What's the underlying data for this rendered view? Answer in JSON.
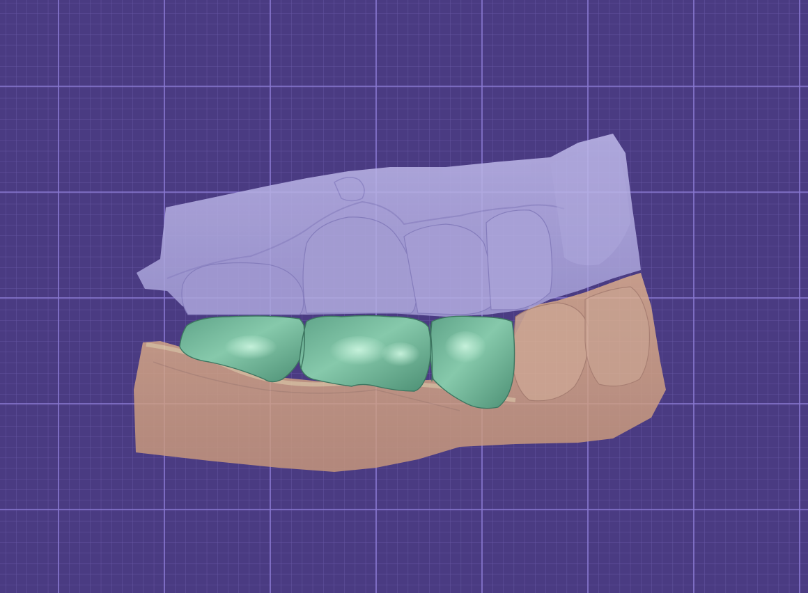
{
  "viewport": {
    "background_color": "#4a3b82",
    "minor_grid_color": "#6a5aa8",
    "major_grid_color": "#8a7ad2"
  },
  "models": [
    {
      "name": "upper-jaw-scan",
      "color": "#b3aee0",
      "opacity": 0.82
    },
    {
      "name": "lower-jaw-scan",
      "color": "#d9aa86",
      "opacity": 0.82
    },
    {
      "name": "bridge-restoration",
      "color": "#79bfa0",
      "opacity": 1
    }
  ]
}
